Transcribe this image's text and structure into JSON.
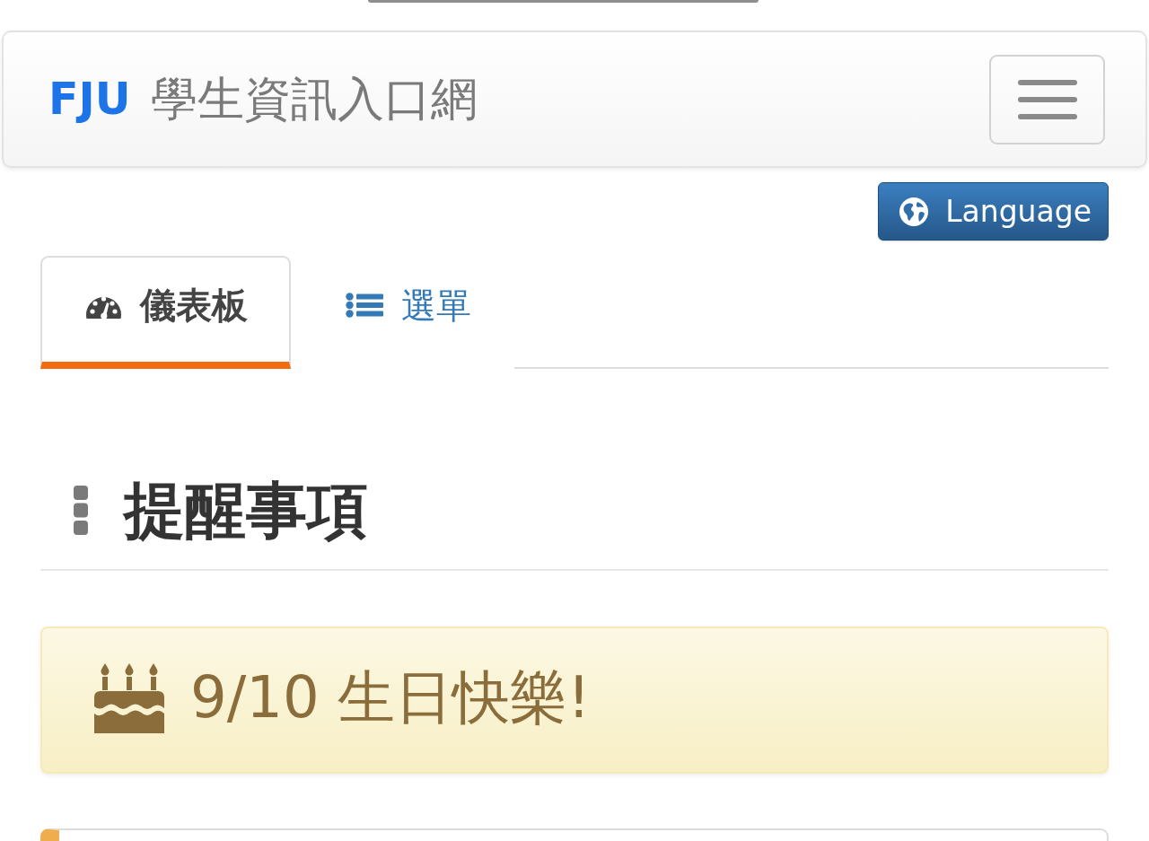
{
  "navbar": {
    "brand": "FJU",
    "title": "學生資訊入口網"
  },
  "language_button": {
    "label": "Language"
  },
  "tabs": [
    {
      "kind": "dashboard",
      "label": "儀表板",
      "selected": true
    },
    {
      "kind": "list",
      "label": "選單",
      "selected": false
    }
  ],
  "section": {
    "title": "提醒事項"
  },
  "alerts": [
    {
      "kind": "birthday",
      "text": "9/10 生日快樂!"
    }
  ]
}
